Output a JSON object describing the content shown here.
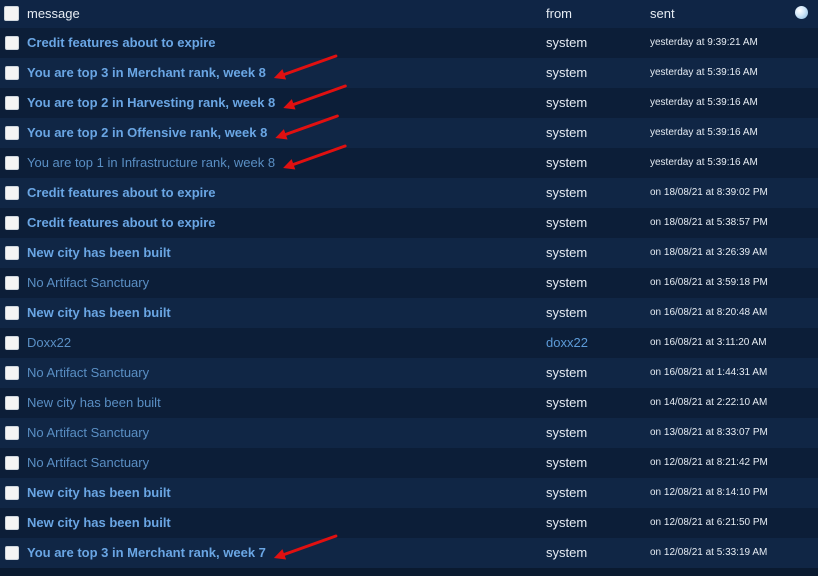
{
  "header": {
    "message_label": "message",
    "from_label": "from",
    "sent_label": "sent"
  },
  "rows": [
    {
      "message": "Credit features about to expire",
      "from": "system",
      "sent": "yesterday at 9:39:21 AM",
      "unread": true
    },
    {
      "message": "You are top 3 in Merchant rank, week 8",
      "from": "system",
      "sent": "yesterday at 5:39:16 AM",
      "unread": true,
      "arrow": true
    },
    {
      "message": "You are top 2 in Harvesting rank, week 8",
      "from": "system",
      "sent": "yesterday at 5:39:16 AM",
      "unread": true,
      "arrow": true
    },
    {
      "message": "You are top 2 in Offensive rank, week 8",
      "from": "system",
      "sent": "yesterday at 5:39:16 AM",
      "unread": true,
      "arrow": true
    },
    {
      "message": "You are top 1 in Infrastructure rank, week 8",
      "from": "system",
      "sent": "yesterday at 5:39:16 AM",
      "unread": false,
      "arrow": true
    },
    {
      "message": "Credit features about to expire",
      "from": "system",
      "sent": "on 18/08/21 at 8:39:02 PM",
      "unread": true
    },
    {
      "message": "Credit features about to expire",
      "from": "system",
      "sent": "on 18/08/21 at 5:38:57 PM",
      "unread": true
    },
    {
      "message": "New city has been built",
      "from": "system",
      "sent": "on 18/08/21 at 3:26:39 AM",
      "unread": true
    },
    {
      "message": "No Artifact Sanctuary",
      "from": "system",
      "sent": "on 16/08/21 at 3:59:18 PM",
      "unread": false
    },
    {
      "message": "New city has been built",
      "from": "system",
      "sent": "on 16/08/21 at 8:20:48 AM",
      "unread": true
    },
    {
      "message": "Doxx22",
      "from": "doxx22",
      "sent": "on 16/08/21 at 3:11:20 AM",
      "unread": false,
      "from_link": true
    },
    {
      "message": "No Artifact Sanctuary",
      "from": "system",
      "sent": "on 16/08/21 at 1:44:31 AM",
      "unread": false
    },
    {
      "message": "New city has been built",
      "from": "system",
      "sent": "on 14/08/21 at 2:22:10 AM",
      "unread": false
    },
    {
      "message": "No Artifact Sanctuary",
      "from": "system",
      "sent": "on 13/08/21 at 8:33:07 PM",
      "unread": false
    },
    {
      "message": "No Artifact Sanctuary",
      "from": "system",
      "sent": "on 12/08/21 at 8:21:42 PM",
      "unread": false
    },
    {
      "message": "New city has been built",
      "from": "system",
      "sent": "on 12/08/21 at 8:14:10 PM",
      "unread": true
    },
    {
      "message": "New city has been built",
      "from": "system",
      "sent": "on 12/08/21 at 6:21:50 PM",
      "unread": true
    },
    {
      "message": "You are top 3 in Merchant rank, week 7",
      "from": "system",
      "sent": "on 12/08/21 at 5:33:19 AM",
      "unread": true,
      "arrow": true
    }
  ],
  "colors": {
    "arrow": "#e01010"
  }
}
